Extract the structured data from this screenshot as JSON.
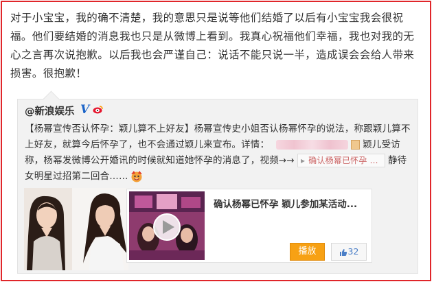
{
  "post": {
    "text": "对于小宝宝，我的确不清楚，我的意思只是说等他们结婚了以后有小宝宝我会很祝福。他们要结婚的消息我也只是从微博上看到。我真心祝福他们幸福，我也对我的无心之言再次说抱歉。以后我也会严谨自己：说话不能只说一半，造成误会会给人带来损害。很抱歉！"
  },
  "repost": {
    "author": "@新浪娱乐",
    "verified_badge": "V",
    "icons": [
      "verified-v-icon",
      "weibo-member-icon",
      "file-icon",
      "video-link-arrow-icon",
      "emoji-icon",
      "play-icon",
      "thumbs-up-icon"
    ],
    "body_part1": "【杨幂宣传否认怀孕：颖儿算不上好友】杨幂宣传史小姐否认杨幂怀孕的说法，称跟颖儿算不上好友，就算今后怀孕了，也不会通过颖儿来宣布。详情：",
    "body_part2": "颖儿受访称，杨幂发微博公开婚讯的时候就知道她怀孕的消息了，视频→→",
    "link_arrow": "▸",
    "link_text": "确认杨幂已怀孕 ...",
    "body_part3": "静待女明星过招第二回合……",
    "video": {
      "title": "确认杨幂已怀孕 颖儿参加某活动...",
      "play_label": "播放",
      "like_count": "32"
    }
  },
  "colors": {
    "frame_border": "#e0262a",
    "play_button": "#f7a114",
    "verified": "#1c64c8",
    "like_text": "#4a7ec7"
  }
}
